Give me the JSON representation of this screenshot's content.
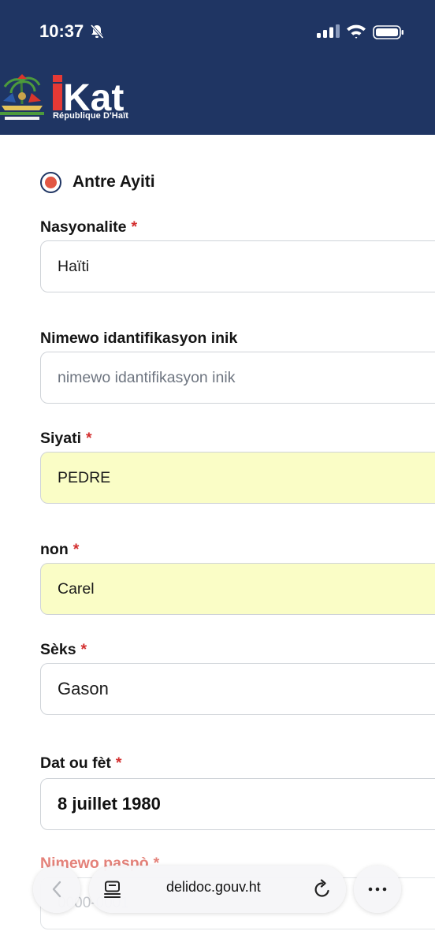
{
  "status_bar": {
    "time": "10:37"
  },
  "header": {
    "logo_text": "Kat",
    "subtitle": "République D'Haït"
  },
  "form": {
    "radio": {
      "label": "Antre Ayiti",
      "selected": true
    },
    "required_mark": "*",
    "nationality": {
      "label": "Nasyonalite",
      "value": "Haïti"
    },
    "nin": {
      "label": "Nimewo idantifikasyon inik",
      "placeholder": "nimewo idantifikasyon inik"
    },
    "surname": {
      "label": "Siyati",
      "value": "PEDRE"
    },
    "first_name": {
      "label": "non",
      "value": "Carel"
    },
    "sex": {
      "label": "Sèks",
      "value": "Gason"
    },
    "birth_date": {
      "label": "Dat ou fèt",
      "value": "8 juillet 1980"
    },
    "passport": {
      "label": "Nimewo paspò",
      "value": "0000-0001"
    }
  },
  "browser": {
    "url": "delidoc.gouv.ht"
  },
  "colors": {
    "header_bg": "#1f3563",
    "accent_red": "#e25744",
    "autofill_yellow": "#fafdc6"
  }
}
